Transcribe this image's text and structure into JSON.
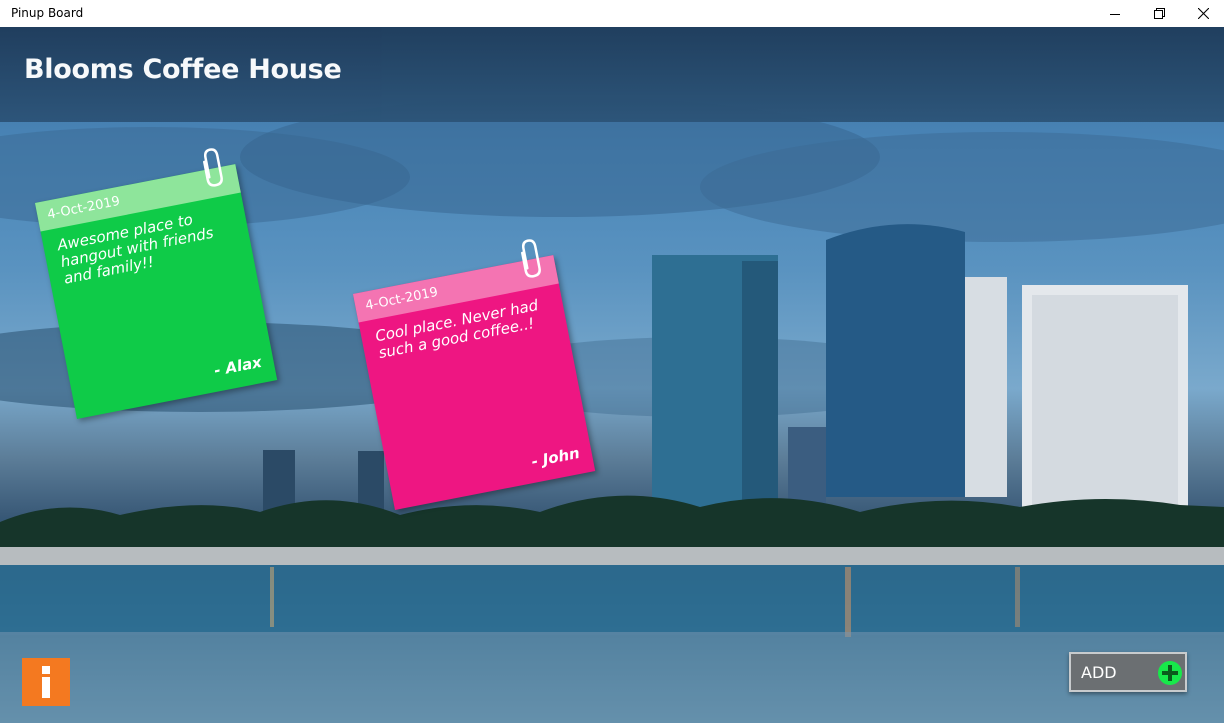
{
  "window": {
    "title": "Pinup Board"
  },
  "header": {
    "title": "Blooms Coffee House"
  },
  "notes": [
    {
      "date": "4-Oct-2019",
      "message": "Awesome place to hangout with friends and family!!",
      "author": "- Alax",
      "color": "#0fcb48",
      "strip_color": "#8ee59b"
    },
    {
      "date": "4-Oct-2019",
      "message": "Cool place. Never had such a good coffee..!",
      "author": "- John",
      "color": "#ee1682",
      "strip_color": "#f474b2"
    }
  ],
  "footer": {
    "info_icon": "info-icon",
    "info_color": "#f47920",
    "add_label": "ADD",
    "add_icon": "plus-circle-icon",
    "add_icon_color": "#17e84a"
  }
}
